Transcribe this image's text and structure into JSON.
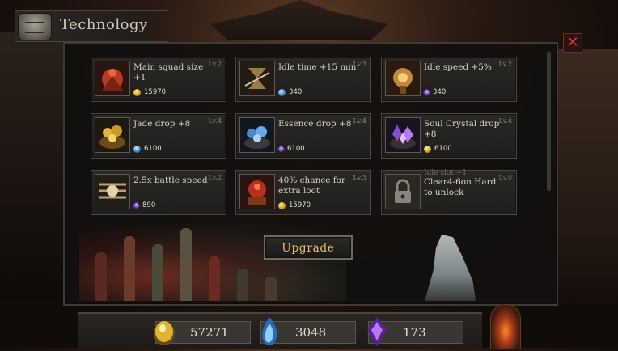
{
  "header": {
    "title": "Technology",
    "icon": "cauldron-icon"
  },
  "close_label": "✕",
  "upgrade_label": "Upgrade",
  "cards": [
    {
      "title": "Main squad size +1",
      "level": "Lv.2",
      "cost": "15970",
      "currency": "gold",
      "icon": "squad-icon",
      "color": "#b83a22"
    },
    {
      "title": "Idle time +15 min",
      "level": "Lv.3",
      "cost": "340",
      "currency": "essence",
      "icon": "hourglass-icon",
      "color": "#9a7a45"
    },
    {
      "title": "Idle speed +5%",
      "level": "Lv.2",
      "cost": "340",
      "currency": "soul",
      "icon": "speed-totem-icon",
      "color": "#c08a3a"
    },
    {
      "title": "Jade drop +8",
      "level": "Lv.4",
      "cost": "6100",
      "currency": "essence",
      "icon": "jade-pile-icon",
      "color": "#c79b2a"
    },
    {
      "title": "Essence drop +8",
      "level": "Lv.4",
      "cost": "6100",
      "currency": "soul",
      "icon": "essence-pile-icon",
      "color": "#4a86c8"
    },
    {
      "title": "Soul Crystal drop +8",
      "level": "Lv.4",
      "cost": "6100",
      "currency": "gold",
      "icon": "soul-crystal-pile-icon",
      "color": "#8d4ad0"
    },
    {
      "title": "2.5x battle speed",
      "level": "Lv.2",
      "cost": "890",
      "currency": "soul",
      "icon": "battle-speed-icon",
      "color": "#b9a27a"
    },
    {
      "title": "40% chance for extra loot",
      "level": "Lv.3",
      "cost": "15970",
      "currency": "gold",
      "icon": "extra-loot-icon",
      "color": "#b5311f"
    },
    {
      "title": "Clear4-6on Hard to unlock",
      "subtitle": "Idle slot +1",
      "level": "Lv.0",
      "locked": true,
      "icon": "lock-icon",
      "color": "#5a554d"
    }
  ],
  "resources": [
    {
      "value": "57271",
      "icon": "gold-coin-icon",
      "color": "#e0b23a"
    },
    {
      "value": "3048",
      "icon": "essence-flame-icon",
      "color": "#4a9be0"
    },
    {
      "value": "173",
      "icon": "soul-crystal-icon",
      "color": "#9a4ae0"
    }
  ]
}
